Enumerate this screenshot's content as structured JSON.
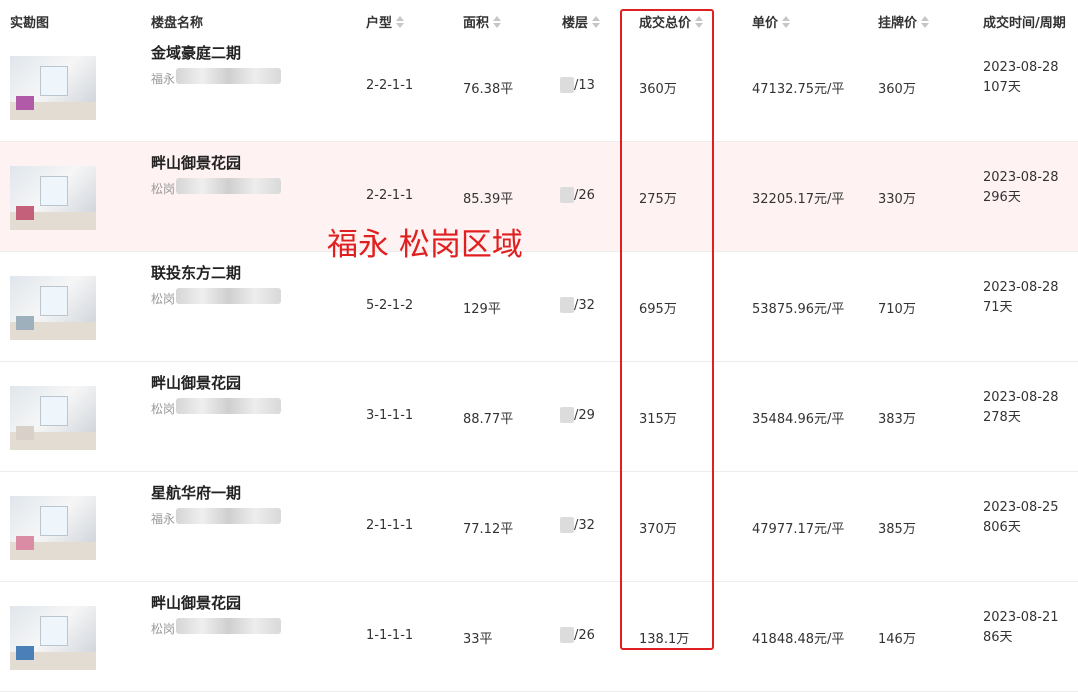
{
  "columns": {
    "photo": "实勘图",
    "name": "楼盘名称",
    "layout": "户型",
    "area": "面积",
    "floor": "楼层",
    "total": "成交总价",
    "unit": "单价",
    "list": "挂牌价",
    "time": "成交时间/周期"
  },
  "annotation": "福永 松岗区域",
  "rows": [
    {
      "name": "金域豪庭二期",
      "district": "福永",
      "layout": "2-2-1-1",
      "area": "76.38平",
      "floor": "/13",
      "total": "360万",
      "unit": "47132.75元/平",
      "list": "360万",
      "date": "2023-08-28",
      "cycle": "107天"
    },
    {
      "name": "畔山御景花园",
      "district": "松岗",
      "layout": "2-2-1-1",
      "area": "85.39平",
      "floor": "/26",
      "total": "275万",
      "unit": "32205.17元/平",
      "list": "330万",
      "date": "2023-08-28",
      "cycle": "296天"
    },
    {
      "name": "联投东方二期",
      "district": "松岗",
      "layout": "5-2-1-2",
      "area": "129平",
      "floor": "/32",
      "total": "695万",
      "unit": "53875.96元/平",
      "list": "710万",
      "date": "2023-08-28",
      "cycle": "71天"
    },
    {
      "name": "畔山御景花园",
      "district": "松岗",
      "layout": "3-1-1-1",
      "area": "88.77平",
      "floor": "/29",
      "total": "315万",
      "unit": "35484.96元/平",
      "list": "383万",
      "date": "2023-08-28",
      "cycle": "278天"
    },
    {
      "name": "星航华府一期",
      "district": "福永",
      "layout": "2-1-1-1",
      "area": "77.12平",
      "floor": "/32",
      "total": "370万",
      "unit": "47977.17元/平",
      "list": "385万",
      "date": "2023-08-25",
      "cycle": "806天"
    },
    {
      "name": "畔山御景花园",
      "district": "松岗",
      "layout": "1-1-1-1",
      "area": "33平",
      "floor": "/26",
      "total": "138.1万",
      "unit": "41848.48元/平",
      "list": "146万",
      "date": "2023-08-21",
      "cycle": "86天"
    }
  ],
  "colors": {
    "highlight_row": "#fff2f2",
    "annotation": "#e02020"
  }
}
